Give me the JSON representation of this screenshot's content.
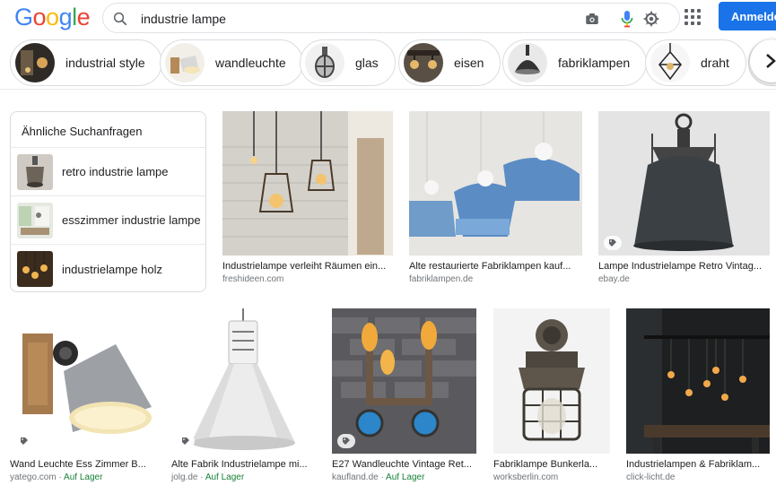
{
  "logo": {
    "letters": [
      "G",
      "o",
      "o",
      "g",
      "l",
      "e"
    ],
    "colors": [
      "#4285f4",
      "#ea4335",
      "#fbbc05",
      "#4285f4",
      "#34a853",
      "#ea4335"
    ]
  },
  "search": {
    "query": "industrie lampe"
  },
  "header": {
    "signin_label": "Anmelden"
  },
  "chips": [
    {
      "label": "industrial style"
    },
    {
      "label": "wandleuchte"
    },
    {
      "label": "glas"
    },
    {
      "label": "eisen"
    },
    {
      "label": "fabriklampen"
    },
    {
      "label": "draht"
    }
  ],
  "related": {
    "title": "Ähnliche Suchanfragen",
    "items": [
      {
        "label": "retro industrie lampe"
      },
      {
        "label": "esszimmer industrie lampe"
      },
      {
        "label": "industrielampe holz"
      }
    ]
  },
  "results": [
    {
      "caption": "Industrielampe verleiht Räumen ein...",
      "source": "freshideen.com",
      "stock": ""
    },
    {
      "caption": "Alte restaurierte Fabriklampen kauf...",
      "source": "fabriklampen.de",
      "stock": ""
    },
    {
      "caption": "Lampe Industrielampe Retro Vintag...",
      "source": "ebay.de",
      "stock": ""
    },
    {
      "caption": "Wand Leuchte Ess Zimmer B...",
      "source": "yatego.com · ",
      "stock": "Auf Lager"
    },
    {
      "caption": "Alte Fabrik Industrielampe mi...",
      "source": "jolg.de · ",
      "stock": "Auf Lager"
    },
    {
      "caption": "E27 Wandleuchte Vintage Ret...",
      "source": "kaufland.de · ",
      "stock": "Auf Lager"
    },
    {
      "caption": "Fabriklampe Bunkerla...",
      "source": "worksberlin.com",
      "stock": ""
    },
    {
      "caption": "Industrielampen & Fabriklam...",
      "source": "click-licht.de",
      "stock": ""
    }
  ],
  "colors": {
    "accent": "#1a73e8",
    "stock": "#188038",
    "border": "#dadce0"
  }
}
